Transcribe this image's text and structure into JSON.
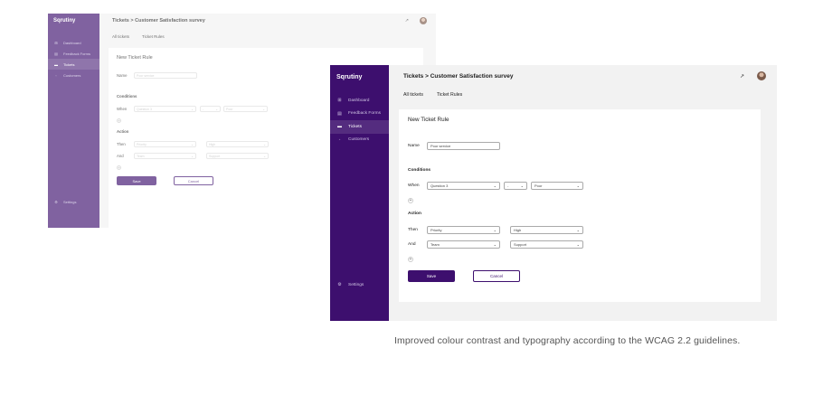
{
  "app": {
    "brand": "Sqrutiny",
    "nav": [
      {
        "label": "Dashboard",
        "icon": "grid-icon"
      },
      {
        "label": "Feedback Forms",
        "icon": "form-icon"
      },
      {
        "label": "Tickets",
        "icon": "ticket-icon"
      },
      {
        "label": "Customers",
        "icon": "user-icon"
      }
    ],
    "settings_label": "Settings",
    "breadcrumb": "Tickets > Customer Satisfaction survey",
    "tabs": [
      "All tickets",
      "Ticket Rules"
    ],
    "form": {
      "title": "New Ticket Rule",
      "name_label": "Name",
      "name_value": "Poor service",
      "conditions_label": "Conditions",
      "when_label": "When",
      "when_question": "Question 3",
      "when_operator": "-",
      "when_value": "Poor",
      "action_label": "Action",
      "then_label": "Then",
      "then_field": "Priority",
      "then_value": "High",
      "and_label": "And",
      "and_field": "Team",
      "and_value": "Support",
      "save_label": "Save",
      "cancel_label": "Cancel"
    }
  },
  "caption": "Improved colour contrast and typography according to the WCAG 2.2 guidelines.",
  "colors": {
    "sidebar": "#3d0f6e",
    "primary_button": "#3d0f6e",
    "background": "#f2f2f2"
  }
}
